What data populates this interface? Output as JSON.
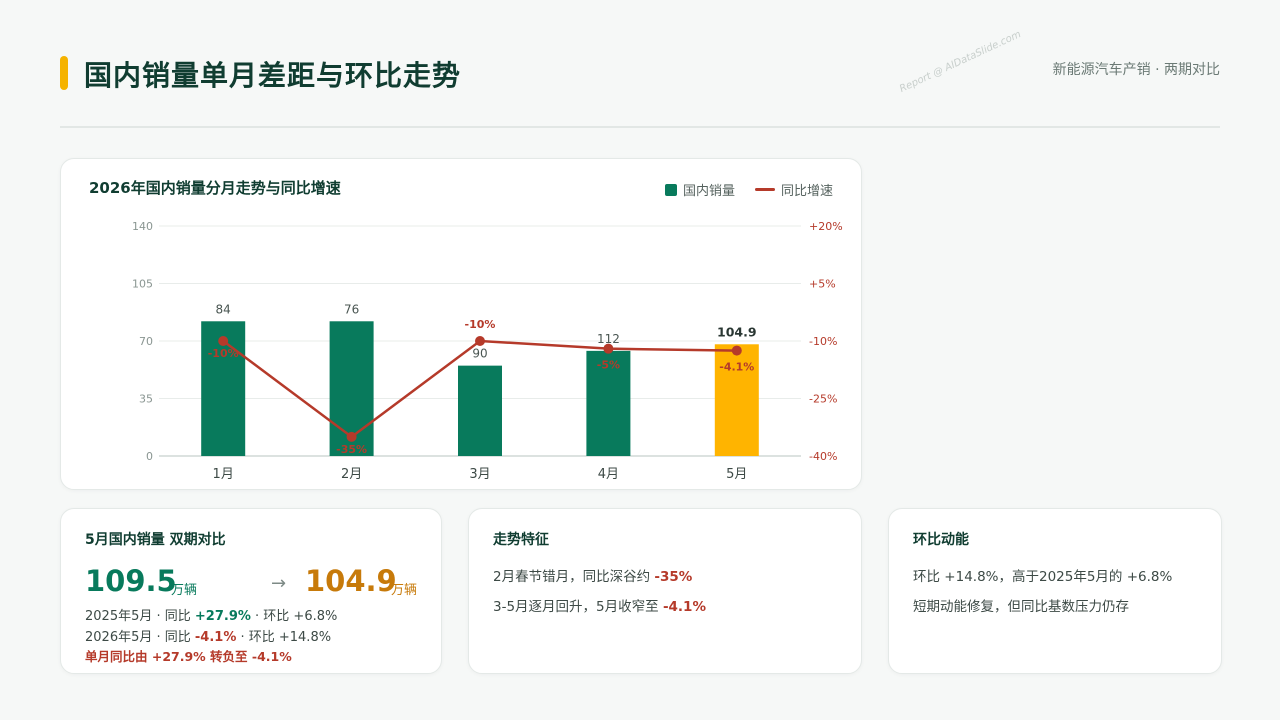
{
  "header": {
    "title": "国内销量单月差距与环比走势",
    "subtitle": "新能源汽车产销 · 两期对比",
    "watermark": "Report @ AIDataSlide.com"
  },
  "colors": {
    "accent": "#f5b300",
    "bar": "#087a5c",
    "bar_highlight": "#ffb400",
    "line": "#b53a2a",
    "title": "#103d31"
  },
  "chart_data": {
    "type": "bar",
    "title": "2026年国内销量分月走势与同比增速",
    "categories": [
      "1月",
      "2月",
      "3月",
      "4月",
      "5月"
    ],
    "series": [
      {
        "name": "国内销量",
        "axis": "left",
        "values": [
          82,
          82,
          55,
          64,
          68
        ],
        "labels": [
          "84",
          "76",
          "90",
          "112",
          "104.9"
        ],
        "highlight_index": 4
      },
      {
        "name": "同比增速",
        "type": "line",
        "axis": "right",
        "values": [
          -10,
          -35,
          -10,
          -12,
          -12.5
        ],
        "labels": [
          "-10%",
          "-35%",
          "-10%",
          "-5%",
          "-4.1%"
        ]
      }
    ],
    "y_left": {
      "ticks": [
        "0",
        "35",
        "70",
        "105",
        "140"
      ],
      "ylim": [
        0,
        140
      ]
    },
    "y_right": {
      "ticks": [
        "-40%",
        "-25%",
        "-10%",
        "+5%",
        "+20%"
      ],
      "ylim": [
        -40,
        20
      ]
    },
    "legend_position": "top-right",
    "grid": true
  },
  "card1": {
    "heading": "5月国内销量 双期对比",
    "old_value": "109.5",
    "new_value": "104.9",
    "unit": "万辆",
    "arrow": "→",
    "row1_prefix": "2025年5月 · 同比 ",
    "row1_yoy": "+27.9%",
    "row1_suffix": " · 环比 +6.8%",
    "row2_prefix": "2026年5月 · 同比 ",
    "row2_yoy": "-4.1%",
    "row2_suffix": " · 环比 +14.8%",
    "row3": "单月同比由 +27.9% 转负至 -4.1%"
  },
  "card2": {
    "heading": "走势特征",
    "line1_prefix": "2月春节错月，同比深谷约 ",
    "line1_value": "-35%",
    "line2_prefix": "3-5月逐月回升，5月收窄至 ",
    "line2_value": "-4.1%"
  },
  "card3": {
    "heading": "环比动能",
    "line1": "环比 +14.8%，高于2025年5月的 +6.8%",
    "line2": "短期动能修复，但同比基数压力仍存"
  }
}
